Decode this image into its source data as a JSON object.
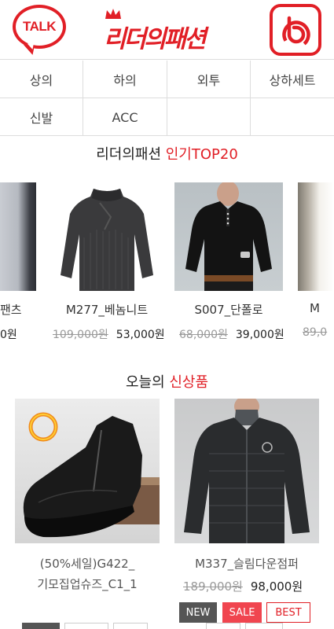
{
  "header": {
    "talk_label": "TALK",
    "logo_text": "리더의패션",
    "talk_icon": "kakao-talk-icon",
    "band_icon": "band-icon"
  },
  "categories": [
    {
      "label": "상의"
    },
    {
      "label": "하의"
    },
    {
      "label": "외투"
    },
    {
      "label": "상하세트"
    },
    {
      "label": "신발"
    },
    {
      "label": "ACC"
    }
  ],
  "top20": {
    "title_plain": "리더의패션 ",
    "title_accent": "인기TOP20",
    "items": [
      {
        "name": "팬츠",
        "old_price": "",
        "price": "0원"
      },
      {
        "name": "M277_베놈니트",
        "old_price": "109,000원",
        "price": "53,000원"
      },
      {
        "name": "S007_단폴로",
        "old_price": "68,000원",
        "price": "39,000원"
      },
      {
        "name": "M",
        "old_price": "89,0",
        "price": ""
      }
    ]
  },
  "new_arrivals": {
    "title_plain": "오늘의 ",
    "title_accent": "신상품",
    "items": [
      {
        "name_line1": "(50%세일)G422_",
        "name_line2": "기모집업슈즈_C1_1",
        "old_price": "",
        "price": ""
      },
      {
        "name_line1": "M337_슬림다운점퍼",
        "name_line2": "",
        "old_price": "189,000원",
        "price": "98,000원"
      }
    ],
    "badges": {
      "new": "NEW",
      "sale": "SALE",
      "best": "BEST"
    }
  },
  "colors": {
    "brand_red": "#e11f26",
    "sale_pink": "#f0454f",
    "new_dark": "#555555"
  }
}
